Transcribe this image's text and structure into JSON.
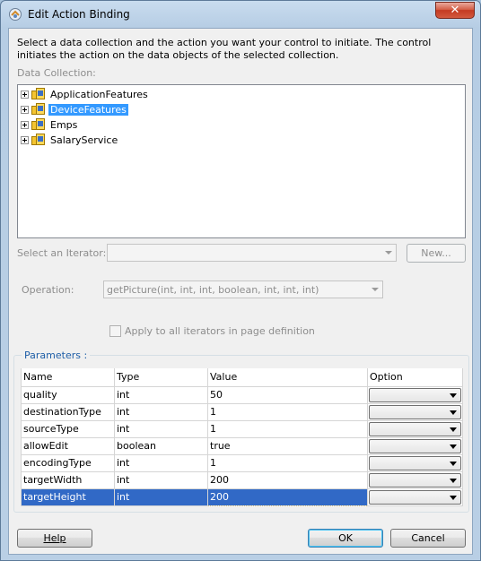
{
  "window": {
    "title": "Edit Action Binding",
    "close_glyph": "✕"
  },
  "description": "Select a data collection and the action you want your control to initiate. The control initiates the action on the data objects of the selected collection.",
  "data_collection": {
    "label": "Data Collection:",
    "items": [
      {
        "label": "ApplicationFeatures",
        "selected": false
      },
      {
        "label": "DeviceFeatures",
        "selected": true
      },
      {
        "label": "Emps",
        "selected": false
      },
      {
        "label": "SalaryService",
        "selected": false
      }
    ]
  },
  "iterator": {
    "label": "Select an Iterator:",
    "value": "",
    "new_button": "New..."
  },
  "operation": {
    "label": "Operation:",
    "value": "getPicture(int, int, int, boolean, int, int, int)"
  },
  "apply_all": {
    "label": "Apply to all iterators in page definition",
    "checked": false
  },
  "parameters": {
    "label": "Parameters :",
    "columns": [
      "Name",
      "Type",
      "Value",
      "Option"
    ],
    "rows": [
      {
        "name": "quality",
        "type": "int",
        "value": "50",
        "option": ""
      },
      {
        "name": "destinationType",
        "type": "int",
        "value": "1",
        "option": ""
      },
      {
        "name": "sourceType",
        "type": "int",
        "value": "1",
        "option": ""
      },
      {
        "name": "allowEdit",
        "type": "boolean",
        "value": "true",
        "option": ""
      },
      {
        "name": "encodingType",
        "type": "int",
        "value": "1",
        "option": ""
      },
      {
        "name": "targetWidth",
        "type": "int",
        "value": "200",
        "option": ""
      },
      {
        "name": "targetHeight",
        "type": "int",
        "value": "200",
        "option": ""
      }
    ],
    "selected_row": "targetHeight"
  },
  "buttons": {
    "help": "Help",
    "ok": "OK",
    "cancel": "Cancel"
  },
  "colors": {
    "selection": "#3399ff",
    "row_selection": "#3169c6",
    "group_label": "#1e5ea7"
  },
  "icons": [
    "binding-icon",
    "close-icon",
    "expand-icon",
    "data-collection-icon",
    "dropdown-arrow-icon",
    "checkbox-icon"
  ]
}
